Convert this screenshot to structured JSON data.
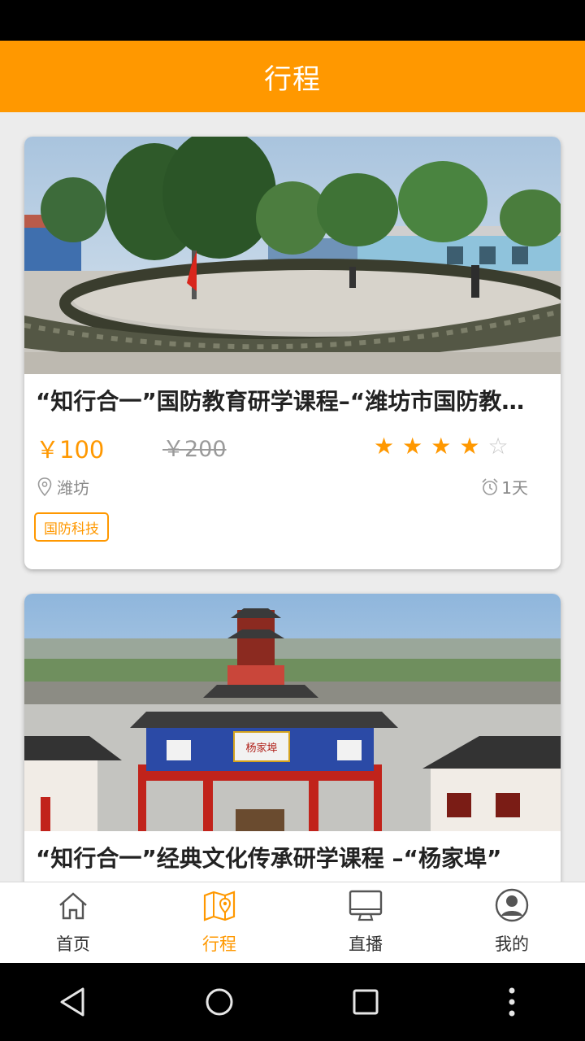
{
  "header": {
    "title": "行程"
  },
  "colors": {
    "accent": "#ff9800",
    "text": "#222222",
    "muted": "#8a8a8a"
  },
  "trips": [
    {
      "title": "“知行合一”国防教育研学课程–“潍坊市国防教育基地”",
      "price_now": "￥100",
      "price_old": "￥200",
      "rating": 4,
      "rating_max": 5,
      "location": "潍坊",
      "duration": "1天",
      "tag": "国防科技",
      "image_icon": "photo-military-training-circle"
    },
    {
      "title": "“知行合一”经典文化传承研学课程 –“杨家埠”",
      "image_icon": "photo-traditional-archway",
      "archway_plaque": "杨家埠"
    }
  ],
  "bottom_nav": {
    "items": [
      {
        "label": "首页",
        "icon": "home-icon"
      },
      {
        "label": "行程",
        "icon": "map-pin-icon",
        "active": true
      },
      {
        "label": "直播",
        "icon": "monitor-icon"
      },
      {
        "label": "我的",
        "icon": "user-icon"
      }
    ]
  },
  "system_nav": {
    "icons": [
      "back-triangle-icon",
      "home-circle-icon",
      "recents-square-icon",
      "more-dots-icon"
    ]
  }
}
